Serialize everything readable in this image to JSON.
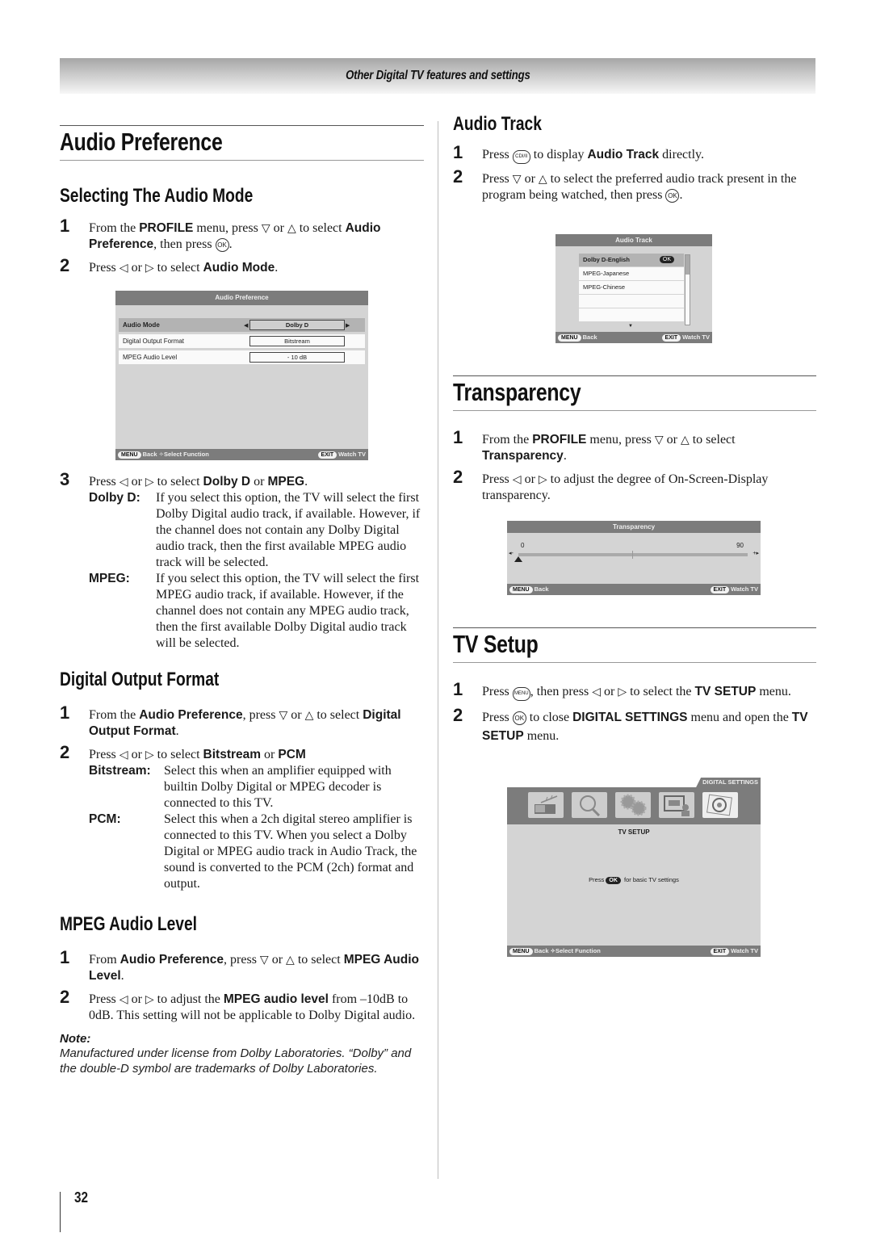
{
  "header": {
    "section_title": "Other Digital TV features and settings"
  },
  "page_number": "32",
  "left": {
    "title": "Audio Preference",
    "selecting_mode": {
      "heading": "Selecting The Audio Mode",
      "step1": {
        "num": "1",
        "t1": "From the ",
        "b1": "PROFILE",
        "t2": " menu, press ",
        "down": "▽",
        "t3": " or ",
        "up": "△",
        "t4": " to select ",
        "b2": "Audio Preference",
        "t5": ", then press ",
        "ok": "OK",
        "t6": "."
      },
      "step2": {
        "num": "2",
        "t1": "Press ",
        "left": "◁",
        "t2": " or ",
        "right": "▷",
        "t3": " to select ",
        "b1": "Audio Mode",
        "t4": "."
      },
      "osd": {
        "title": "Audio Preference",
        "rows": [
          {
            "label": "Audio Mode",
            "value": "Dolby D"
          },
          {
            "label": "Digital Output Format",
            "value": "Bitstream"
          },
          {
            "label": "MPEG Audio Level",
            "value": "- 10 dB"
          }
        ],
        "footer": {
          "menu": "MENU",
          "back": "Back",
          "select_icon": "✧",
          "select": "Select Function",
          "exit": "EXIT",
          "watch": "Watch TV"
        }
      },
      "step3": {
        "num": "3",
        "t1": "Press ",
        "left": "◁",
        "t2": " or ",
        "right": "▷",
        "t3": " to select ",
        "b1": "Dolby D",
        "t4": " or ",
        "b2": "MPEG",
        "t5": ".",
        "defs": [
          {
            "term": "Dolby D",
            "sep": ":",
            "text": "If you select this option, the TV will select the first Dolby Digital audio track, if available. However, if the channel does not contain any Dolby Digital audio track, then the first available MPEG audio track will be selected."
          },
          {
            "term": "MPEG",
            "sep": ":",
            "text": "If you select this option, the TV will select the first MPEG audio track, if available. However, if the channel does not contain any MPEG audio track, then the first available Dolby Digital audio track will be selected."
          }
        ]
      }
    },
    "digital_output": {
      "heading": "Digital Output Format",
      "step1": {
        "num": "1",
        "t1": "From the ",
        "b1": "Audio Preference",
        "t2": ", press ",
        "down": "▽",
        "t3": " or ",
        "up": "△",
        "t4": " to select ",
        "b2": "Digital Output Format",
        "t5": "."
      },
      "step2": {
        "num": "2",
        "t1": "Press ",
        "left": "◁",
        "t2": " or ",
        "right": "▷",
        "t3": " to select ",
        "b1": "Bitstream",
        "t4": " or ",
        "b2": "PCM"
      },
      "defs": [
        {
          "term": "Bitstream",
          "sep": ":",
          "text": "Select this when an amplifier equipped with builtin Dolby Digital or MPEG decoder is connected to this TV."
        },
        {
          "term": "PCM",
          "sep": ":",
          "text": "Select this when a 2ch digital stereo amplifier is connected to this TV. When you select a Dolby Digital or MPEG audio track in Audio Track, the sound is converted to the PCM (2ch) format and output."
        }
      ]
    },
    "mpeg_level": {
      "heading": "MPEG Audio Level",
      "step1": {
        "num": "1",
        "t1": "From ",
        "b1": "Audio Preference",
        "t2": ", press ",
        "down": "▽",
        "t3": " or ",
        "up": "△",
        "t4": " to select ",
        "b2": "MPEG Audio Level",
        "t5": "."
      },
      "step2": {
        "num": "2",
        "t1": "Press ",
        "left": "◁",
        "t2": " or ",
        "right": "▷",
        "t3": " to adjust the ",
        "b1": "MPEG audio level",
        "t4": " from –10dB to 0dB. This setting will not be applicable to Dolby Digital audio."
      },
      "note_title": "Note:",
      "note_body": "Manufactured under license from Dolby Laboratories. “Dolby” and the double-D symbol are trademarks of Dolby Laboratories."
    }
  },
  "right": {
    "audio_track": {
      "heading": "Audio Track",
      "step1": {
        "num": "1",
        "t1": "Press ",
        "btn": "CDI/II",
        "t2": " to display ",
        "b1": "Audio Track",
        "t3": " directly."
      },
      "step2": {
        "num": "2",
        "t1": "Press ",
        "down": "▽",
        "t2": " or ",
        "up": "△",
        "t3": " to select the preferred audio track present in the program being watched, then press ",
        "ok": "OK",
        "t4": "."
      },
      "osd": {
        "title": "Audio Track",
        "items": [
          "Dolby D-English",
          "MPEG-Japanese",
          "MPEG-Chinese",
          "",
          ""
        ],
        "ok": "OK",
        "footer": {
          "menu": "MENU",
          "back": "Back",
          "exit": "EXIT",
          "watch": "Watch TV"
        }
      }
    },
    "transparency": {
      "title": "Transparency",
      "step1": {
        "num": "1",
        "t1": "From the ",
        "b1": "PROFILE",
        "t2": " menu, press ",
        "down": "▽",
        "t3": " or ",
        "up": "△",
        "t4": " to select ",
        "b2": "Transparency",
        "t5": "."
      },
      "step2": {
        "num": "2",
        "t1": "Press ",
        "left": "◁",
        "t2": " or ",
        "right": "▷",
        "t3": " to adjust the degree of On-Screen-Display transparency."
      },
      "osd": {
        "title": "Transparency",
        "min": "0",
        "max": "90",
        "value": 0,
        "minus": "◂-",
        "plus": "+▸",
        "footer": {
          "menu": "MENU",
          "back": "Back",
          "exit": "EXIT",
          "watch": "Watch TV"
        }
      }
    },
    "tv_setup": {
      "title": "TV Setup",
      "step1": {
        "num": "1",
        "t1": "Press ",
        "btn": "MENU",
        "t2": ", then press ",
        "left": "◁",
        "t3": " or ",
        "right": "▷",
        "t4": " to select the ",
        "b1": "TV SETUP",
        "t5": " menu."
      },
      "step2": {
        "num": "2",
        "t1": "Press ",
        "ok": "OK",
        "t2": " to close ",
        "b1": "DIGITAL SETTINGS",
        "t3": " menu and open the ",
        "b2": "TV SETUP",
        "t4": " menu."
      },
      "osd": {
        "tab": "DIGITAL SETTINGS",
        "icons": [
          "antenna-icon",
          "search-icon",
          "gears-icon",
          "screen-person-icon",
          "disc-icon"
        ],
        "menu_title": "TV SETUP",
        "msg_pre": "Press ",
        "msg_ok": "OK",
        "msg_post": " for basic TV settings",
        "footer": {
          "menu": "MENU",
          "back": "Back",
          "select_icon": "✧",
          "select": "Select Function",
          "exit": "EXIT",
          "watch": "Watch TV"
        }
      }
    }
  }
}
